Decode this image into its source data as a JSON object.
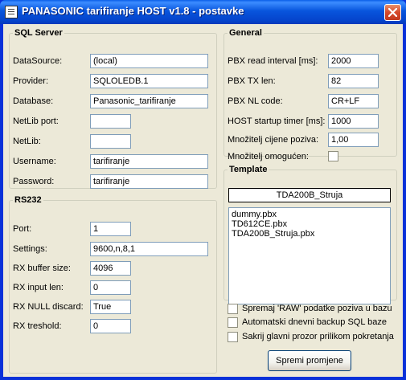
{
  "window": {
    "title": "PANASONIC tarifiranje HOST v1.8 - postavke",
    "accent": "#0831D9",
    "close_icon": "close-icon"
  },
  "sql": {
    "legend": "SQL Server",
    "fields": [
      {
        "label": "DataSource:",
        "value": "(local)"
      },
      {
        "label": "Provider:",
        "value": "SQLOLEDB.1"
      },
      {
        "label": "Database:",
        "value": "Panasonic_tarifiranje"
      },
      {
        "label": "NetLib port:",
        "value": ""
      },
      {
        "label": "NetLib:",
        "value": ""
      },
      {
        "label": "Username:",
        "value": "tarifiranje"
      },
      {
        "label": "Password:",
        "value": "tarifiranje"
      }
    ]
  },
  "rs232": {
    "legend": "RS232",
    "fields": [
      {
        "label": "Port:",
        "value": "1"
      },
      {
        "label": "Settings:",
        "value": "9600,n,8,1"
      },
      {
        "label": "RX buffer size:",
        "value": "4096"
      },
      {
        "label": "RX input len:",
        "value": "0"
      },
      {
        "label": "RX NULL discard:",
        "value": "True"
      },
      {
        "label": "RX treshold:",
        "value": "0"
      }
    ]
  },
  "general": {
    "legend": "General",
    "fields": [
      {
        "label": "PBX read interval [ms]:",
        "value": "2000"
      },
      {
        "label": "PBX TX len:",
        "value": "82"
      },
      {
        "label": "PBX NL code:",
        "value": "CR+LF"
      },
      {
        "label": "HOST startup timer [ms]:",
        "value": "1000"
      },
      {
        "label": "Množitelj cijene poziva:",
        "value": "1,00"
      }
    ],
    "multiplier_enabled_label": "Množitelj omogućen:"
  },
  "template": {
    "legend": "Template",
    "selected": "TDA200B_Struja",
    "items": [
      "dummy.pbx",
      "TD612CE.pbx",
      "TDA200B_Struja.pbx"
    ]
  },
  "options": [
    "Spremaj 'RAW' podatke poziva u bazu",
    "Automatski dnevni backup SQL baze",
    "Sakrij glavni prozor prilikom pokretanja"
  ],
  "save_button": "Spremi promjene"
}
